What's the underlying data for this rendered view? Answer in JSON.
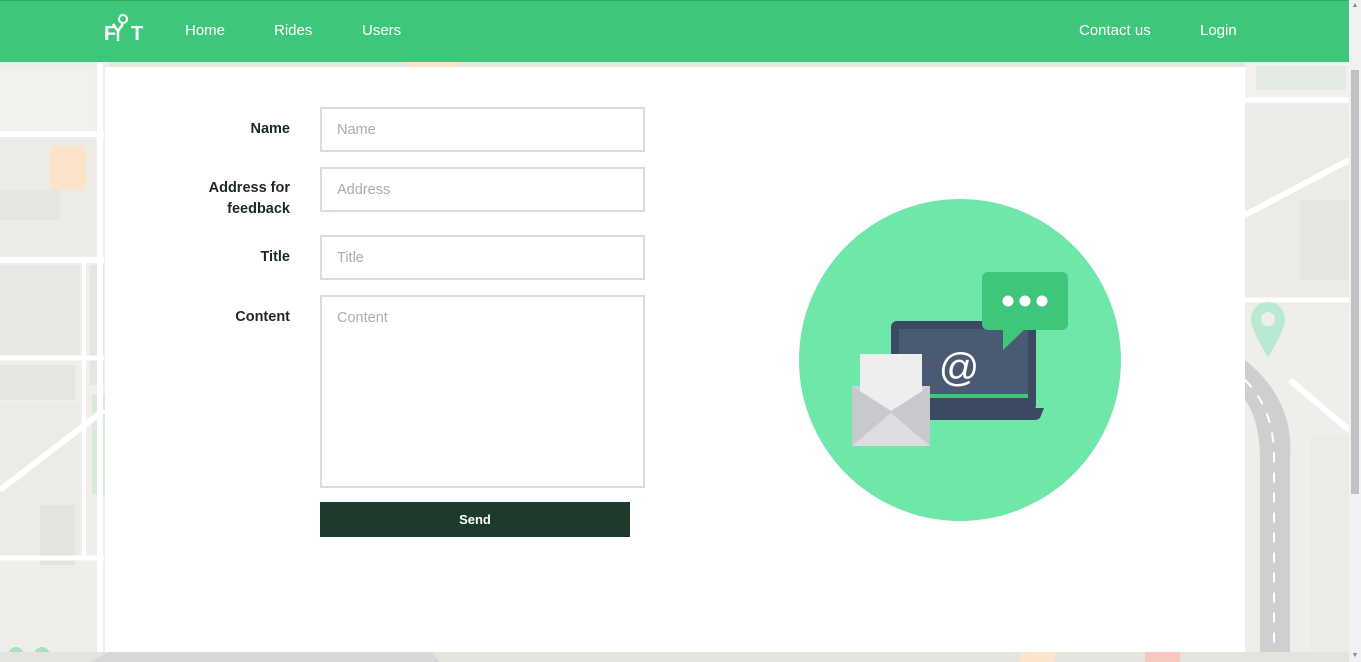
{
  "nav": {
    "logo": "FYT",
    "links": [
      "Home",
      "Rides",
      "Users"
    ],
    "right_links": [
      "Contact us",
      "Login"
    ]
  },
  "form": {
    "name_label": "Name",
    "name_placeholder": "Name",
    "address_label_line1": "Address for",
    "address_label_line2": "feedback",
    "address_placeholder": "Address",
    "title_label": "Title",
    "title_placeholder": "Title",
    "content_label": "Content",
    "content_placeholder": "Content",
    "send_label": "Send"
  },
  "illustration": {
    "at_symbol": "@",
    "icons": [
      "laptop-icon",
      "envelope-icon",
      "chat-bubble-icon"
    ]
  },
  "colors": {
    "brand_green": "#3ec67b",
    "circle_green": "#6ee7a9",
    "button_dark": "#1d3a2b"
  }
}
